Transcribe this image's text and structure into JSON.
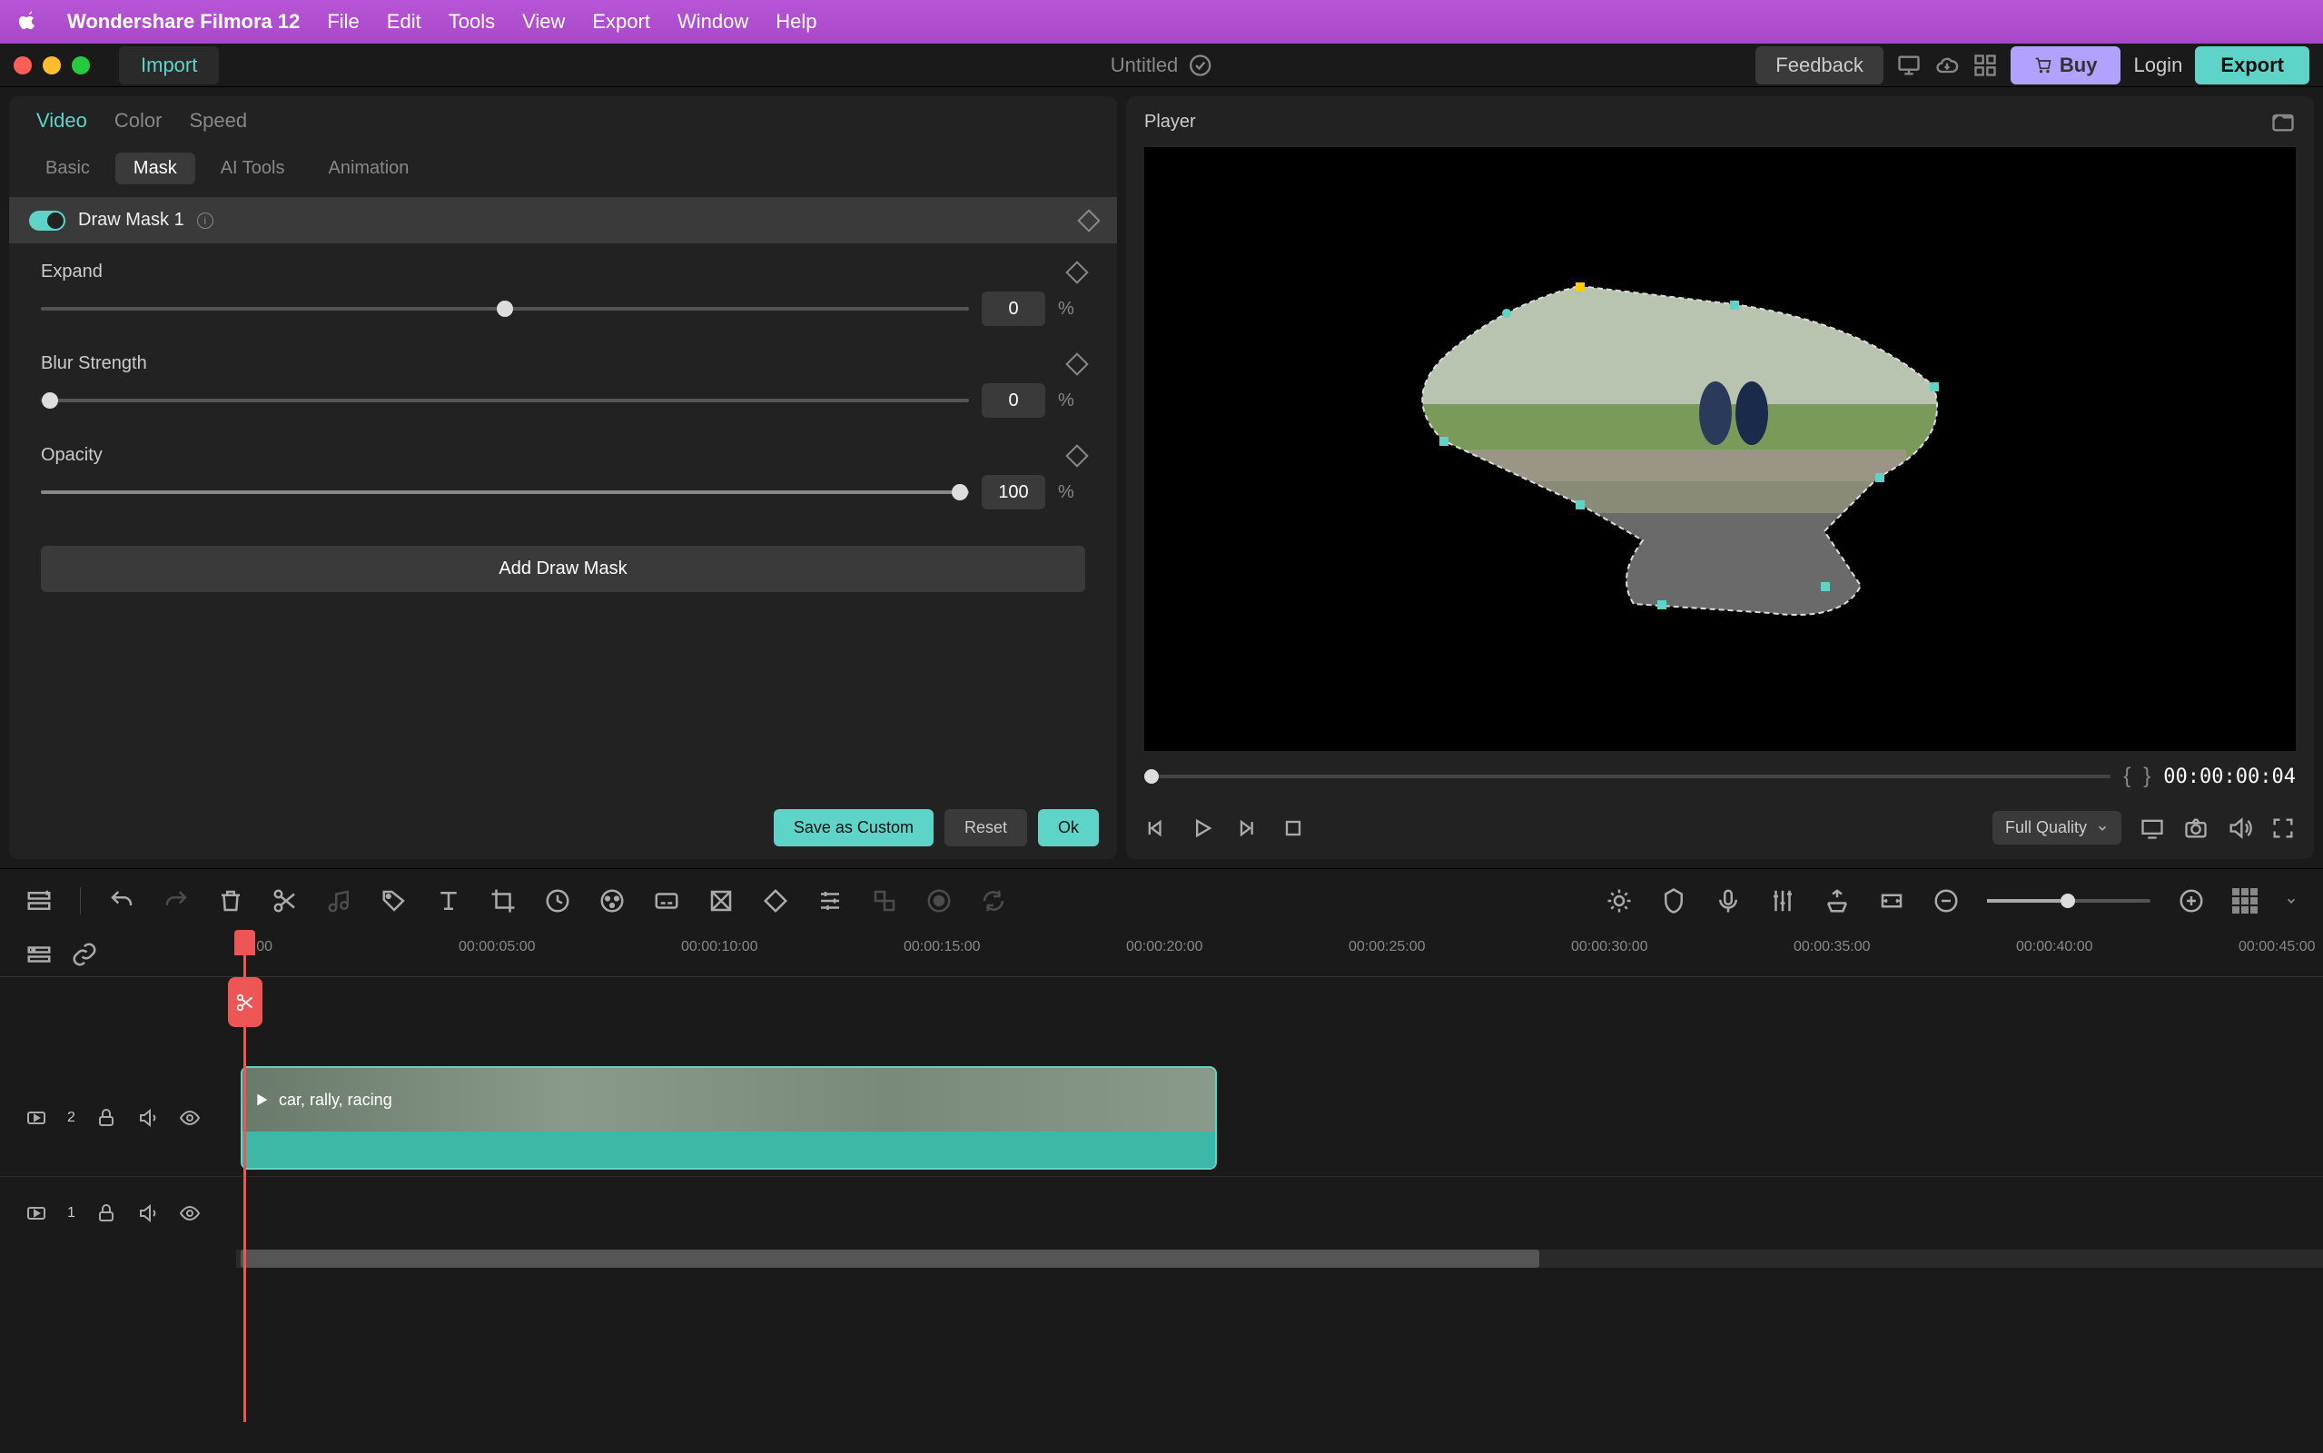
{
  "menubar": {
    "app": "Wondershare Filmora 12",
    "items": [
      "File",
      "Edit",
      "Tools",
      "View",
      "Export",
      "Window",
      "Help"
    ]
  },
  "titlebar": {
    "import": "Import",
    "project": "Untitled",
    "feedback": "Feedback",
    "buy": "Buy",
    "login": "Login",
    "export": "Export"
  },
  "properties": {
    "tabs": [
      "Video",
      "Color",
      "Speed"
    ],
    "active_tab": "Video",
    "subtabs": [
      "Basic",
      "Mask",
      "AI Tools",
      "Animation"
    ],
    "active_subtab": "Mask",
    "mask_name": "Draw Mask 1",
    "controls": {
      "expand": {
        "label": "Expand",
        "value": "0",
        "unit": "%"
      },
      "blur": {
        "label": "Blur Strength",
        "value": "0",
        "unit": "%"
      },
      "opacity": {
        "label": "Opacity",
        "value": "100",
        "unit": "%"
      }
    },
    "add_mask": "Add Draw Mask",
    "save_custom": "Save as Custom",
    "reset": "Reset",
    "ok": "Ok"
  },
  "player": {
    "title": "Player",
    "timecode": "00:00:00:04",
    "quality": "Full Quality"
  },
  "timeline": {
    "marks": [
      "00:00",
      "00:00:05:00",
      "00:00:10:00",
      "00:00:15:00",
      "00:00:20:00",
      "00:00:25:00",
      "00:00:30:00",
      "00:00:35:00",
      "00:00:40:00",
      "00:00:45:00"
    ],
    "tracks": [
      {
        "num": "2",
        "clip": "car, rally, racing"
      },
      {
        "num": "1"
      }
    ]
  }
}
